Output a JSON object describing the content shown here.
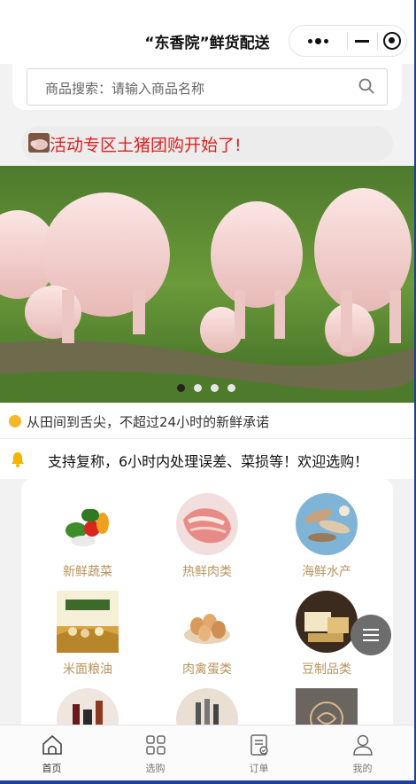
{
  "title_bar": {
    "title": "“东香院”鲜货配送"
  },
  "search": {
    "placeholder": "商品搜索：请输入商品名称"
  },
  "notice": {
    "text": "活动专区土猪团购开始了!"
  },
  "banner": {
    "slide_count": 4,
    "active_slide": 1
  },
  "promise": {
    "text": "从田间到舌尖，不超过24小时的新鲜承诺"
  },
  "announcement": {
    "text": "支持复称，6小时内处理误差、菜损等！欢迎选购！"
  },
  "categories": [
    {
      "label": "新鲜蔬菜",
      "icon": "vegetables-image"
    },
    {
      "label": "热鲜肉类",
      "icon": "pork-image"
    },
    {
      "label": "海鲜水产",
      "icon": "seafood-image"
    },
    {
      "label": "米面粮油",
      "icon": "grain-oil-image"
    },
    {
      "label": "肉禽蛋类",
      "icon": "eggs-image"
    },
    {
      "label": "豆制品类",
      "icon": "tofu-image"
    },
    {
      "label": "",
      "icon": "condiments-image"
    },
    {
      "label": "",
      "icon": "kitchenware-image"
    },
    {
      "label": "",
      "icon": "brand-logo-image"
    }
  ],
  "tabbar": {
    "tabs": [
      {
        "label": "首页",
        "icon": "home-icon",
        "active": true
      },
      {
        "label": "选购",
        "icon": "grid-icon",
        "active": false
      },
      {
        "label": "订单",
        "icon": "order-icon",
        "active": false
      },
      {
        "label": "我的",
        "icon": "user-icon",
        "active": false
      }
    ]
  },
  "colors": {
    "accent": "#e41e1e",
    "category_label": "#b9935c",
    "promise_dot": "#f7b52c"
  }
}
